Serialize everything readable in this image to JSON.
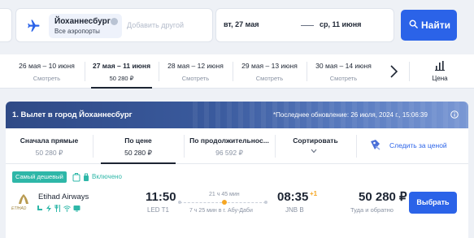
{
  "search": {
    "destination_title": "Йоханнесбург",
    "destination_sub": "Все аэропорты",
    "add_other_placeholder": "Добавить другой",
    "date_from": "вт, 27 мая",
    "date_to": "ср, 11 июня",
    "find_label": "Найти"
  },
  "date_strip": {
    "items": [
      {
        "range": "26 мая – 10 июня",
        "sub": "Смотреть",
        "active": false
      },
      {
        "range": "27 мая – 11 июня",
        "sub": "50 280 ₽",
        "active": true
      },
      {
        "range": "28 мая – 12 июня",
        "sub": "Смотреть",
        "active": false
      },
      {
        "range": "29 мая – 13 июня",
        "sub": "Смотреть",
        "active": false
      },
      {
        "range": "30 мая – 14 июня",
        "sub": "Смотреть",
        "active": false
      }
    ],
    "price_label": "Цена"
  },
  "results": {
    "banner_title": "1. Вылет в город Йоханнесбург",
    "banner_update": "*Последнее обновление: 26 июля, 2024 г., 15:06:39",
    "sorts": [
      {
        "title": "Сначала прямые",
        "value": "50 280 ₽"
      },
      {
        "title": "По цене",
        "value": "50 280 ₽"
      },
      {
        "title": "По продолжительнос...",
        "value": "96 592 ₽"
      },
      {
        "title": "Сортировать",
        "value": ""
      }
    ],
    "follow_label": "Следить за ценой",
    "flight": {
      "badge": "Самый дешевый",
      "included": "Включено",
      "airline": "Etihad Airways",
      "logo_text": "ETIHAD",
      "dep_time": "11:50",
      "dep_port": "LED T1",
      "duration": "21 ч 45 мин",
      "layover": "7 ч 25 мин в г. Абу-Даби",
      "arr_time": "08:35",
      "plus_day": "+1",
      "arr_port": "JNB B",
      "price": "50 280 ₽",
      "price_note": "Туда и обратно",
      "choose_label": "Выбрать"
    }
  },
  "colors": {
    "accent": "#2b63e8",
    "teal": "#2eb7a8",
    "stop": "#f5a623",
    "banner": "#3a5a9d"
  }
}
